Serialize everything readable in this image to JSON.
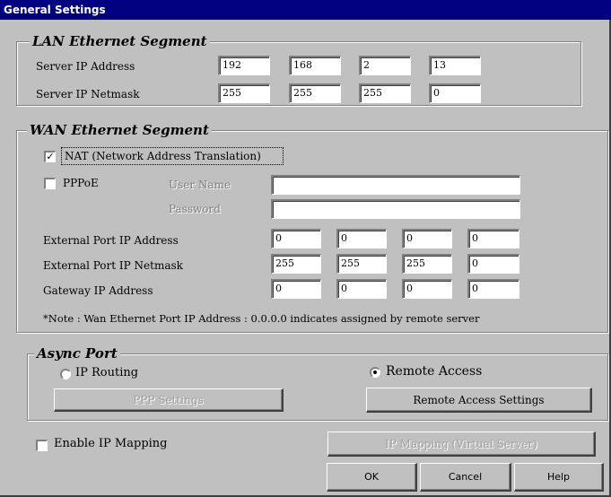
{
  "window": {
    "title": "General Settings"
  },
  "lan": {
    "legend": "LAN Ethernet Segment",
    "server_ip_label": "Server IP Address",
    "server_ip": [
      "192",
      "168",
      "2",
      "13"
    ],
    "server_netmask_label": "Server IP Netmask",
    "server_netmask": [
      "255",
      "255",
      "255",
      "0"
    ]
  },
  "wan": {
    "legend": "WAN Ethernet Segment",
    "nat_label": "NAT (Network Address Translation)",
    "nat_checked": true,
    "nat_mark": "✓",
    "pppoe_label": "PPPoE",
    "pppoe_checked": false,
    "username_label": "User Name",
    "username_value": "",
    "password_label": "Password",
    "password_value": "",
    "ext_ip_label": "External Port IP Address",
    "ext_ip": [
      "0",
      "0",
      "0",
      "0"
    ],
    "ext_netmask_label": "External Port IP Netmask",
    "ext_netmask": [
      "255",
      "255",
      "255",
      "0"
    ],
    "gateway_label": "Gateway IP Address",
    "gateway": [
      "0",
      "0",
      "0",
      "0"
    ],
    "note": "*Note : Wan Ethernet Port IP Address : 0.0.0.0  indicates assigned by remote server"
  },
  "async": {
    "legend": "Async Port",
    "ip_routing_label": "IP Routing",
    "ip_routing_selected": false,
    "remote_access_label": "Remote Access",
    "remote_access_selected": true,
    "ppp_settings_label": "PPP Settings",
    "remote_access_settings_label": "Remote Access Settings"
  },
  "mapping": {
    "enable_label": "Enable IP Mapping",
    "enable_checked": false,
    "mapping_button_label": "IP Mapping (Virtual Server)"
  },
  "buttons": {
    "ok": "OK",
    "cancel": "Cancel",
    "help": "Help"
  },
  "colors": {
    "title_bar": "#000080",
    "face": "#c0c0c0"
  }
}
